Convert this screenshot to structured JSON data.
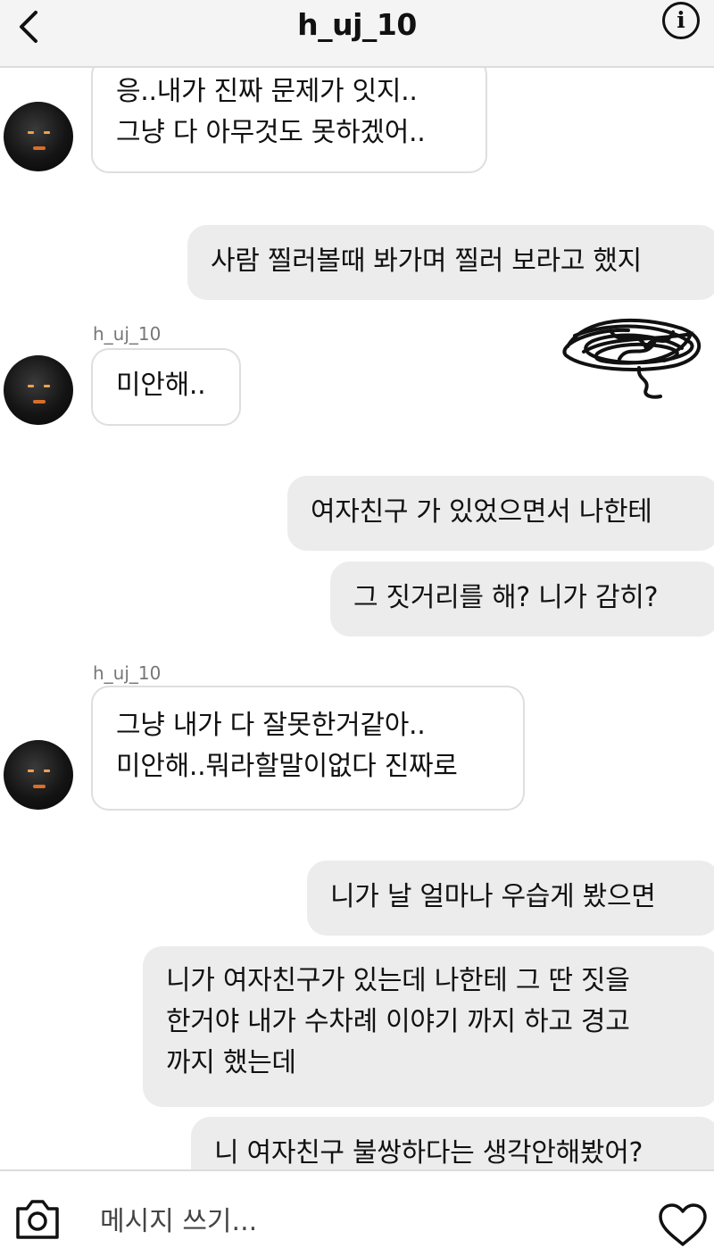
{
  "header": {
    "title": "h_uj_10",
    "info_glyph": "i",
    "back_icon": "chevron-left-icon",
    "info_icon": "info-icon"
  },
  "sender_name": "h_uj_10",
  "messages": [
    {
      "side": "received",
      "text": "응..내가 진짜 문제가 잇지..\n그냥 다 아무것도 못하겠어.."
    },
    {
      "side": "sent",
      "text": "사람 찔러볼때 봐가며 찔러 보라고 했지"
    },
    {
      "side": "received",
      "text": "미안해.."
    },
    {
      "side": "sent",
      "text": "여자친구 가 있었으면서 나한테"
    },
    {
      "side": "sent",
      "text": "그 짓거리를 해? 니가 감히?"
    },
    {
      "side": "received",
      "text": "그냥 내가 다 잘못한거같아..\n미안해..뭐라할말이없다 진짜로"
    },
    {
      "side": "sent",
      "text": "니가 날 얼마나 우습게 봤으면"
    },
    {
      "side": "sent",
      "text": "니가 여자친구가 있는데 나한테 그 딴 짓을\n한거야 내가 수차례 이야기 까지 하고 경고\n까지 했는데"
    },
    {
      "side": "sent",
      "text": "니 여자친구 불쌍하다는 생각안해봤어?"
    }
  ],
  "composer": {
    "placeholder": "메시지 쓰기...",
    "camera_icon": "camera-icon",
    "heart_icon": "heart-icon"
  },
  "colors": {
    "sent_bubble": "#ececec",
    "received_bubble": "#ffffff",
    "bubble_border": "#dedede",
    "header_bg": "#f4f4f4"
  }
}
